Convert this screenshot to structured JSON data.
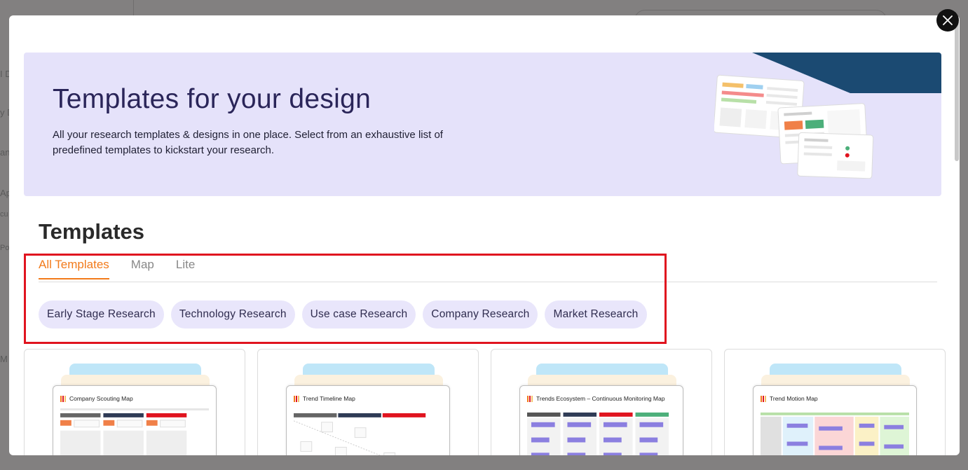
{
  "background": {
    "fragments": [
      "I D",
      "y D",
      "an",
      "Ap",
      "cu",
      "Po",
      "M"
    ]
  },
  "close_button": {
    "icon": "close-icon"
  },
  "hero": {
    "title": "Templates for your design",
    "description": "All your research templates & designs in one place. Select from an exhaustive list of predefined templates to kickstart your research.",
    "accent_color": "#1b4a72",
    "background_color": "#e5e2fa"
  },
  "section": {
    "title": "Templates"
  },
  "tabs": [
    {
      "label": "All Templates",
      "active": true
    },
    {
      "label": "Map",
      "active": false
    },
    {
      "label": "Lite",
      "active": false
    }
  ],
  "filters": [
    {
      "label": "Early Stage Research"
    },
    {
      "label": "Technology Research"
    },
    {
      "label": "Use case Research"
    },
    {
      "label": "Company Research"
    },
    {
      "label": "Market Research"
    }
  ],
  "cards": [
    {
      "title": "Company Scouting Map"
    },
    {
      "title": "Trend Timeline Map"
    },
    {
      "title": "Trends Ecosystem – Continuous Monitoring Map"
    },
    {
      "title": "Trend Motion Map"
    }
  ],
  "colors": {
    "accent": "#f27a1a",
    "highlight": "#e0141f",
    "chip_bg": "#e9e6fb"
  }
}
